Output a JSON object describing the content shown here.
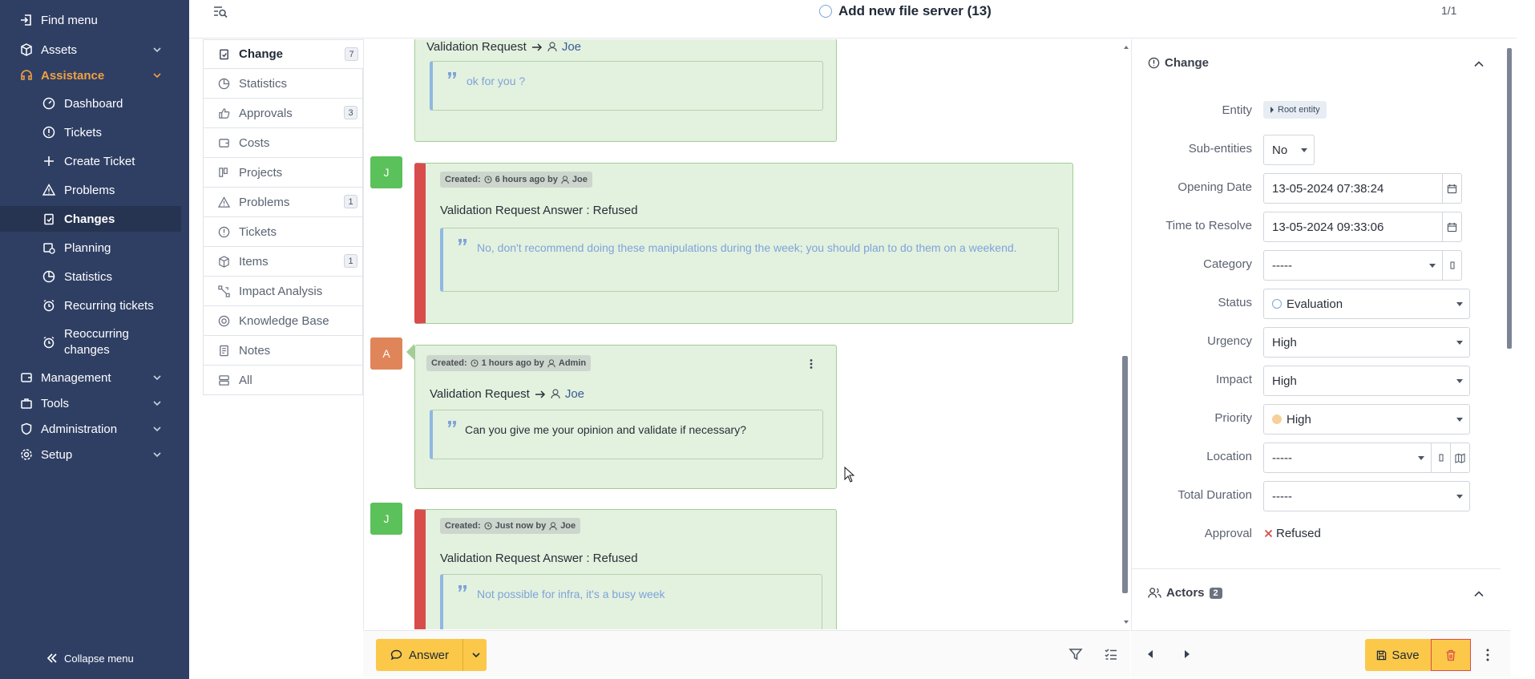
{
  "sidebar": {
    "find_menu": "Find menu",
    "assets": "Assets",
    "assistance": "Assistance",
    "dashboard": "Dashboard",
    "tickets": "Tickets",
    "create_ticket": "Create Ticket",
    "problems": "Problems",
    "changes": "Changes",
    "planning": "Planning",
    "statistics": "Statistics",
    "recurring_tickets": "Recurring tickets",
    "reoccurring_changes_1": "Reoccurring",
    "reoccurring_changes_2": "changes",
    "management": "Management",
    "tools": "Tools",
    "administration": "Administration",
    "setup": "Setup",
    "collapse": "Collapse menu"
  },
  "header": {
    "title": "Add new file server (13)",
    "pager": "1/1"
  },
  "tabs": [
    {
      "label": "Change",
      "count": "7"
    },
    {
      "label": "Statistics",
      "count": ""
    },
    {
      "label": "Approvals",
      "count": "3"
    },
    {
      "label": "Costs",
      "count": ""
    },
    {
      "label": "Projects",
      "count": ""
    },
    {
      "label": "Problems",
      "count": "1"
    },
    {
      "label": "Tickets",
      "count": ""
    },
    {
      "label": "Items",
      "count": "1"
    },
    {
      "label": "Impact Analysis",
      "count": ""
    },
    {
      "label": "Knowledge Base",
      "count": ""
    },
    {
      "label": "Notes",
      "count": ""
    },
    {
      "label": "All",
      "count": ""
    }
  ],
  "timeline": {
    "item0": {
      "title": "Validation Request",
      "user": "Joe",
      "quote": "ok for you ?"
    },
    "item1": {
      "avatar": "J",
      "created": "Created:",
      "when": "6 hours ago by",
      "user": "Joe",
      "title": "Validation Request Answer : Refused",
      "quote": "No, don't recommend doing these manipulations during the week; you should plan to do them on a weekend."
    },
    "item2": {
      "avatar": "A",
      "created": "Created:",
      "when": "1 hours ago by",
      "user": "Admin",
      "title": "Validation Request",
      "target": "Joe",
      "quote": "Can you give me your opinion and validate if necessary?"
    },
    "item3": {
      "avatar": "J",
      "created": "Created:",
      "when": "Just now by",
      "user": "Joe",
      "title": "Validation Request Answer : Refused",
      "quote": "Not possible for infra, it's a busy week"
    }
  },
  "bottom": {
    "answer": "Answer",
    "save": "Save"
  },
  "panel": {
    "section": "Change",
    "entity_label": "Entity",
    "entity_value": "Root entity",
    "subentities_label": "Sub-entities",
    "subentities_value": "No",
    "opening_label": "Opening Date",
    "opening_value": "13-05-2024 07:38:24",
    "ttr_label": "Time to Resolve",
    "ttr_value": "13-05-2024 09:33:06",
    "category_label": "Category",
    "category_value": "-----",
    "status_label": "Status",
    "status_value": "Evaluation",
    "urgency_label": "Urgency",
    "urgency_value": "High",
    "impact_label": "Impact",
    "impact_value": "High",
    "priority_label": "Priority",
    "priority_value": "High",
    "location_label": "Location",
    "location_value": "-----",
    "duration_label": "Total Duration",
    "duration_value": "-----",
    "approval_label": "Approval",
    "approval_value": "Refused",
    "actors": "Actors",
    "actors_count": "2"
  },
  "colors": {
    "sidebar_bg": "#2f3f64",
    "accent_orange": "#f0a142",
    "button_yellow": "#fbc84a",
    "bubble_green": "#e3f1df",
    "refused_red": "#d94c4c",
    "avatar_joe": "#5bc15b",
    "avatar_admin": "#e0855a"
  }
}
